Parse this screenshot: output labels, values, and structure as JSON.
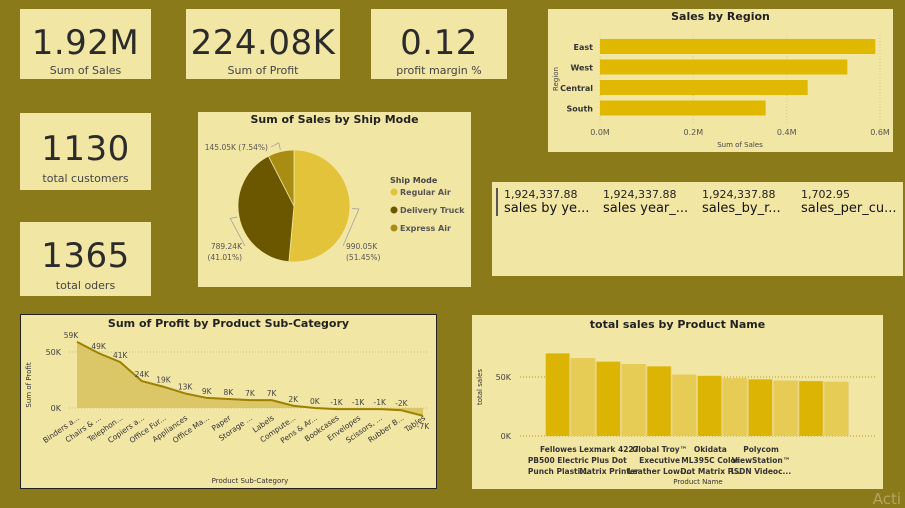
{
  "kpis": {
    "sales": {
      "value": "1.92M",
      "label": "Sum of Sales"
    },
    "profit": {
      "value": "224.08K",
      "label": "Sum of Profit"
    },
    "margin": {
      "value": "0.12",
      "label": "profit margin %"
    },
    "customers": {
      "value": "1130",
      "label": "total customers"
    },
    "orders": {
      "value": "1365",
      "label": "total oders"
    }
  },
  "multi_row_card": {
    "items": [
      {
        "value": "1,924,337.88",
        "label": "sales by ye..."
      },
      {
        "value": "1,924,337.88",
        "label": "sales year_..."
      },
      {
        "value": "1,924,337.88",
        "label": "sales_by_r..."
      },
      {
        "value": "1,702.95",
        "label": "sales_per_cu..."
      }
    ]
  },
  "watermark": "Acti",
  "colors": {
    "background": "#8b7a1a",
    "card": "#f2e6a4",
    "bar": "#e0b800",
    "pie_regular": "#e3c33a",
    "pie_delivery": "#6b5700",
    "pie_express": "#a88d12"
  },
  "chart_data": [
    {
      "id": "region",
      "type": "bar",
      "orientation": "horizontal",
      "title": "Sales by Region",
      "xlabel": "Sum of Sales",
      "ylabel": "Region",
      "categories": [
        "East",
        "West",
        "Central",
        "South"
      ],
      "values": [
        590000,
        530000,
        445000,
        355000
      ],
      "xlim": [
        0,
        600000
      ],
      "ticks": [
        "0.0M",
        "0.2M",
        "0.4M",
        "0.6M"
      ],
      "grid": true
    },
    {
      "id": "shipmode",
      "type": "pie",
      "title": "Sum of Sales by Ship Mode",
      "legend_title": "Ship Mode",
      "legend_position": "right",
      "slices": [
        {
          "name": "Regular Air",
          "value": 990050,
          "label": "990.05K",
          "pct": "(51.45%)"
        },
        {
          "name": "Delivery Truck",
          "value": 789240,
          "label": "789.24K",
          "pct": "(41.01%)"
        },
        {
          "name": "Express Air",
          "value": 145050,
          "label": "145.05K (7.54%)",
          "pct": ""
        }
      ]
    },
    {
      "id": "subcategory",
      "type": "area",
      "title": "Sum of Profit by Product Sub-Category",
      "xlabel": "Product Sub-Category",
      "ylabel": "Sum of Profit",
      "categories": [
        "Binders a...",
        "Chairs & ...",
        "Telephon...",
        "Copiers a...",
        "Office Fur...",
        "Appliances",
        "Office Ma...",
        "Paper",
        "Storage ...",
        "Labels",
        "Compute...",
        "Pens & Ar...",
        "Bookcases",
        "Envelopes",
        "Scissors, ...",
        "Rubber B...",
        "Tables"
      ],
      "values": [
        59000,
        49000,
        41000,
        24000,
        19000,
        13000,
        9000,
        8000,
        7000,
        7000,
        2000,
        0,
        -1000,
        -1000,
        -1000,
        -2000,
        -7000
      ],
      "data_labels": [
        "59K",
        "49K",
        "41K",
        "24K",
        "19K",
        "13K",
        "9K",
        "8K",
        "7K",
        "7K",
        "2K",
        "0K",
        "-1K",
        "-1K",
        "-1K",
        "-2K",
        "-7K"
      ],
      "yticks": [
        "50K",
        "0K"
      ],
      "ylim": [
        -12000,
        62000
      ]
    },
    {
      "id": "product",
      "type": "bar",
      "title": "total sales by Product Name",
      "xlabel": "Product Name",
      "ylabel": "total sales",
      "categories": [
        [
          "Fellowes",
          "PB500 Electric",
          "Punch Plasti..."
        ],
        [
          "Lexmark 4227",
          "Plus Dot",
          "Matrix Printer"
        ],
        [
          "Global Troy™",
          "Executive",
          "Leather Low-..."
        ],
        [
          "Okidata",
          "ML395C Color",
          "Dot Matrix P..."
        ],
        [
          "Polycom",
          "ViewStation™",
          "ISDN Videoc..."
        ]
      ],
      "values": [
        70000,
        66000,
        63000,
        61000,
        59000,
        52000,
        51000,
        49000,
        48000,
        47000,
        46500,
        46000
      ],
      "yticks": [
        "50K",
        "0K"
      ],
      "ylim": [
        0,
        75000
      ]
    }
  ]
}
